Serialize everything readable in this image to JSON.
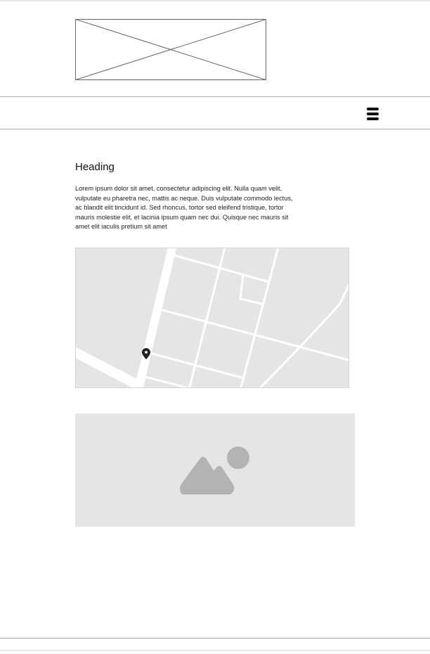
{
  "header": {
    "logo_icon": "image-placeholder-cross-icon"
  },
  "navbar": {
    "menu_icon": "hamburger-menu-icon"
  },
  "content": {
    "heading": "Heading",
    "paragraph": "Lorem ipsum dolor sit amet, consectetur adipiscing elit. Nulla quam velit, vulputate eu pharetra nec, mattis ac neque. Duis vulputate commodo lectus, ac blandit elit tincidunt id. Sed rhoncus, tortor sed eleifend tristique, tortor mauris molestie elit, et lacinia ipsum quam nec dui. Quisque nec mauris sit amet elit iaculis pretium sit amet",
    "map_marker_icon": "map-pin-icon",
    "image_icon": "mountain-sun-image-icon"
  },
  "colors": {
    "placeholder_fill": "#e5e5e5",
    "placeholder_icon": "#b3b3b3",
    "rule": "#a8a8a8"
  }
}
